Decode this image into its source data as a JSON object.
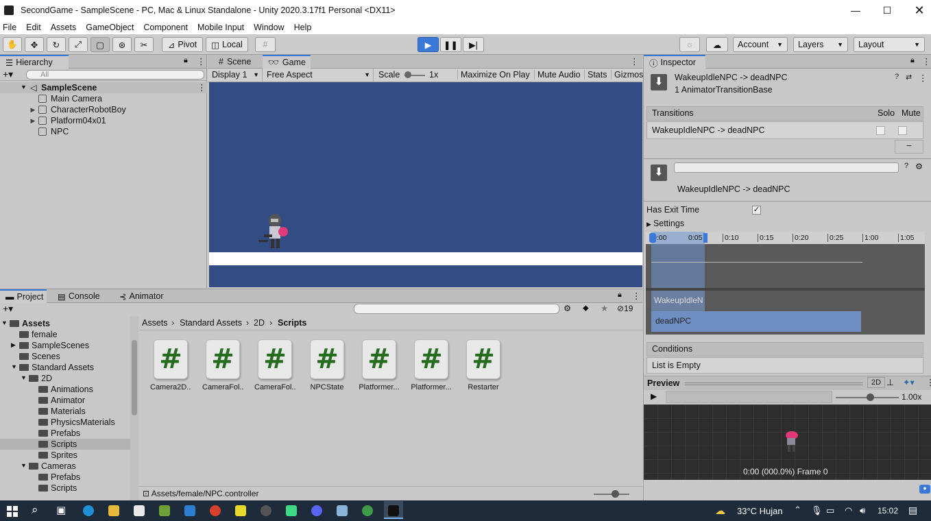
{
  "window": {
    "title": "SecondGame - SampleScene - PC, Mac & Linux Standalone - Unity 2020.3.17f1 Personal <DX11>"
  },
  "menu": [
    "File",
    "Edit",
    "Assets",
    "GameObject",
    "Component",
    "Mobile Input",
    "Window",
    "Help"
  ],
  "toolbar": {
    "pivot": "Pivot",
    "local": "Local",
    "account": "Account",
    "layers": "Layers",
    "layout": "Layout"
  },
  "hierarchy": {
    "tab": "Hierarchy",
    "search_placeholder": "All",
    "scene": "SampleScene",
    "items": [
      "Main Camera",
      "CharacterRobotBoy",
      "Platform04x01",
      "NPC"
    ]
  },
  "scene_view": {
    "tabs": [
      "Scene",
      "Game"
    ],
    "display": "Display 1",
    "aspect": "Free Aspect",
    "scale_label": "Scale",
    "scale_value": "1x",
    "maximize": "Maximize On Play",
    "mute": "Mute Audio",
    "stats": "Stats",
    "gizmos": "Gizmos"
  },
  "project": {
    "tabs": [
      "Project",
      "Console",
      "Animator"
    ],
    "hidden_count": "19",
    "breadcrumb": [
      "Assets",
      "Standard Assets",
      "2D",
      "Scripts"
    ],
    "tree": [
      {
        "label": "Assets",
        "level": 0,
        "open": true,
        "bold": true
      },
      {
        "label": "female",
        "level": 1
      },
      {
        "label": "SampleScenes",
        "level": 1,
        "arrow": true
      },
      {
        "label": "Scenes",
        "level": 1
      },
      {
        "label": "Standard Assets",
        "level": 1,
        "open": true
      },
      {
        "label": "2D",
        "level": 2,
        "open": true
      },
      {
        "label": "Animations",
        "level": 3
      },
      {
        "label": "Animator",
        "level": 3
      },
      {
        "label": "Materials",
        "level": 3
      },
      {
        "label": "PhysicsMaterials",
        "level": 3
      },
      {
        "label": "Prefabs",
        "level": 3
      },
      {
        "label": "Scripts",
        "level": 3,
        "selected": true
      },
      {
        "label": "Sprites",
        "level": 3
      },
      {
        "label": "Cameras",
        "level": 2,
        "open": true
      },
      {
        "label": "Prefabs",
        "level": 3
      },
      {
        "label": "Scripts",
        "level": 3
      }
    ],
    "scripts": [
      "Camera2D...",
      "CameraFol...",
      "CameraFol...",
      "NPCState",
      "Platformer...",
      "Platformer...",
      "Restarter"
    ],
    "status_path": "Assets/female/NPC.controller"
  },
  "inspector": {
    "tab": "Inspector",
    "header_title": "WakeupIdleNPC -> deadNPC",
    "header_sub": "1 AnimatorTransitionBase",
    "transitions_label": "Transitions",
    "solo": "Solo",
    "mute": "Mute",
    "transition_row": "WakeupIdleNPC -> deadNPC",
    "minus": "–",
    "transition_name": "WakeupIdleNPC -> deadNPC",
    "has_exit_time": "Has Exit Time",
    "settings": "Settings",
    "timeline_ticks": [
      "0:00",
      "0:05",
      "0:10",
      "0:15",
      "0:20",
      "0:25",
      "1:00",
      "1:05"
    ],
    "track_a": "WakeupIdleN",
    "track_b": "deadNPC",
    "conditions": "Conditions",
    "list_empty": "List is Empty",
    "preview": "Preview",
    "preview_2d": "2D",
    "speed": "1.00x",
    "frame_info": "0:00 (000.0%) Frame 0"
  },
  "taskbar": {
    "weather": "33°C  Hujan",
    "time": "15:02"
  },
  "colors": {
    "game_bg": "#344c84",
    "accent": "#3a79d7",
    "script_hash": "#256c1f"
  }
}
